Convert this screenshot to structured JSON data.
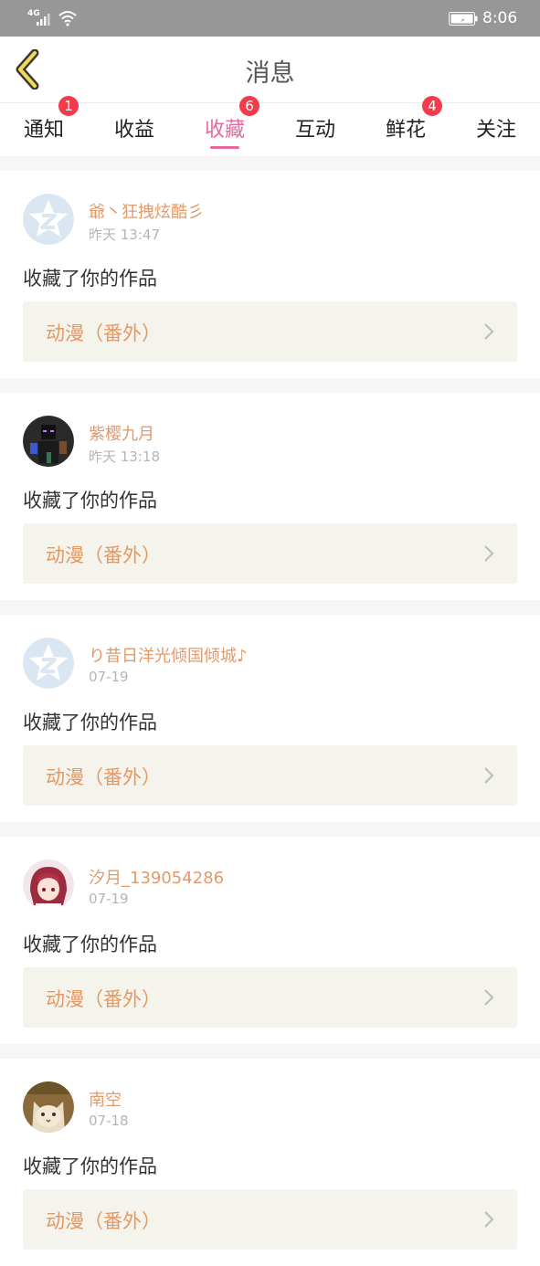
{
  "status_bar": {
    "network": "4G",
    "time": "8:06"
  },
  "header": {
    "title": "消息"
  },
  "tabs": [
    {
      "label": "通知",
      "badge": "1"
    },
    {
      "label": "收益",
      "badge": null
    },
    {
      "label": "收藏",
      "badge": "6",
      "active": true
    },
    {
      "label": "互动",
      "badge": null
    },
    {
      "label": "鲜花",
      "badge": "4"
    },
    {
      "label": "关注",
      "badge": null
    }
  ],
  "colors": {
    "accent": "#e8699d",
    "badge": "#f23b4b",
    "username": "#e29a6a",
    "work_title": "#e49862"
  },
  "feed": [
    {
      "username": "爺丶狂拽炫酷彡",
      "time": "昨天 13:47",
      "action": "收藏了你的作品",
      "work": "动漫（番外）",
      "avatar": "default-star-avatar"
    },
    {
      "username": "紫樱九月",
      "time": "昨天 13:18",
      "action": "收藏了你的作品",
      "work": "动漫（番外）",
      "avatar": "dark-character-avatar"
    },
    {
      "username": "り昔日洋光倾国倾城♪",
      "time": "07-19",
      "action": "收藏了你的作品",
      "work": "动漫（番外）",
      "avatar": "default-star-avatar"
    },
    {
      "username": "汐月_139054286",
      "time": "07-19",
      "action": "收藏了你的作品",
      "work": "动漫（番外）",
      "avatar": "anime-girl-avatar"
    },
    {
      "username": "南空",
      "time": "07-18",
      "action": "收藏了你的作品",
      "work": "动漫（番外）",
      "avatar": "cat-photo-avatar"
    }
  ]
}
